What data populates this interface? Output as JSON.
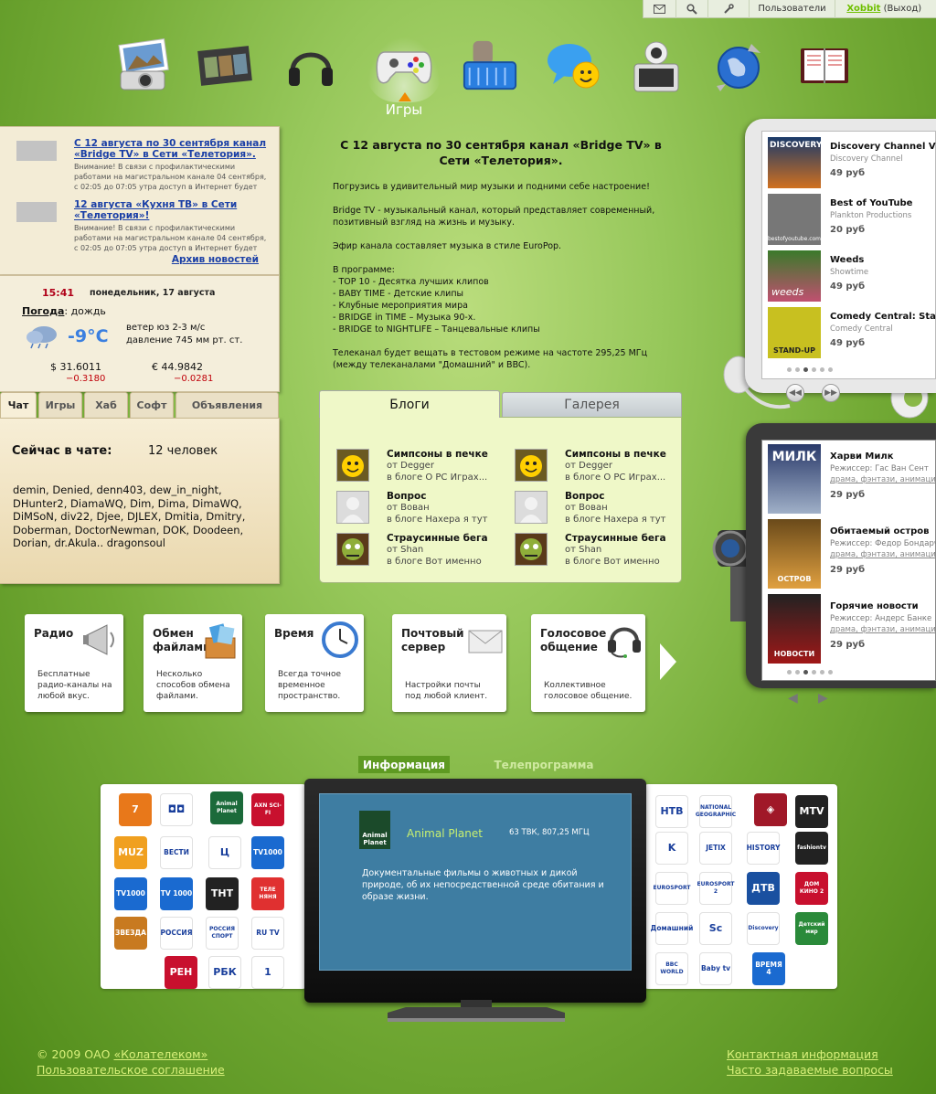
{
  "topbar": {
    "users": "Пользователи",
    "username": "Xobbit",
    "logout": "(Выход)"
  },
  "nav": {
    "active_label": "Игры",
    "icons": [
      "photo-camera-icon",
      "film-strip-icon",
      "headphones-icon",
      "gamepad-icon",
      "shopping-basket-icon",
      "chat-bubble-icon",
      "webcam-icon",
      "globe-icon",
      "planner-icon"
    ]
  },
  "news": {
    "items": [
      {
        "title": "С 12 августа по 30 сентября канал «Bridge TV» в Сети «Телетория».",
        "text": "Внимание! В связи с профилактическими работами на магистральном канале 04 сентября, с 02:05 до 07:05 утра доступ в Интернет будет"
      },
      {
        "title": "12 августа «Кухня ТВ» в Сети «Телетория»!",
        "text": "Внимание! В связи с профилактическими работами на магистральном канале 04 сентября, с 02:05 до 07:05 утра доступ в Интернет будет"
      }
    ],
    "archive": "Архив новостей"
  },
  "weather": {
    "time": "15:41",
    "date": "понедельник, 17 августа",
    "label": "Погода",
    "condition": "дождь",
    "temp": "-9°C",
    "wind": "ветер юз 2-3 м/с",
    "pressure": "давление 745 мм рт. ст.",
    "usd": "$ 31.6011",
    "usd_change": "−0.3180",
    "eur": "€ 44.9842",
    "eur_change": "−0.0281"
  },
  "tabs": [
    "Чат",
    "Игры",
    "Хаб",
    "Софт",
    "Объявления"
  ],
  "chat": {
    "heading": "Сейчас в чате:",
    "count": "12 человек",
    "users": "demin, Denied, denn403, dew_in_night, DHunter2, DiamaWQ, Dim, Dima, DimaWQ, DiMSoN, div22, Djee, DJLEX, Dmitia, Dmitry, Doberman, DoctorNewman, DOK, Doodeen, Dorian, dr.Akula.. dragonsoul"
  },
  "article": {
    "title": "С 12 августа по 30 сентября канал «Bridge TV» в Сети «Телетория».",
    "p1": "Погрузись в удивительный мир музыки и подними себе настроение!",
    "p2": "Bridge TV - музыкальный канал, который представляет современный, позитивный взгляд на жизнь и музыку.",
    "p3": "Эфир канала составляет музыка в стиле EuroPop.",
    "p4_head": "В программе:",
    "program": [
      "- TOP 10 - Десятка лучших клипов",
      "- BABY TIME - Детские клипы",
      "- Клубные мероприятия мира",
      "- BRIDGE in TIME – Музыка 90-х.",
      "- BRIDGE to NIGHTLIFE – Танцевальные клипы"
    ],
    "p5": "Телеканал будет вещать в тестовом режиме на частоте 295,25 МГц (между телеканалами \"Домашний\" и BBC)."
  },
  "blogs": {
    "tab_blogs": "Блоги",
    "tab_gallery": "Галерея",
    "entries": [
      {
        "title": "Симпсоны в печке",
        "author": "от Degger",
        "blog": "в блоге О PC Играх..."
      },
      {
        "title": "Симпсоны в печке",
        "author": "от Degger",
        "blog": "в блоге О PC Играх..."
      },
      {
        "title": "Вопрос",
        "author": "от Вован",
        "blog": "в блоге Нахера я тут"
      },
      {
        "title": "Вопрос",
        "author": "от Вован",
        "blog": "в блоге Нахера я тут"
      },
      {
        "title": "Страусинные бега",
        "author": "от Shan",
        "blog": "в блоге Вот именно"
      },
      {
        "title": "Страусинные бега",
        "author": "от Shan",
        "blog": "в блоге Вот именно"
      }
    ]
  },
  "store_video": [
    {
      "title": "Discovery Channel Video",
      "sub": "Discovery Channel",
      "price": "49 руб",
      "thumb": "DISCOVERY"
    },
    {
      "title": "Best of YouTube",
      "sub": "Plankton Productions",
      "price": "20 руб",
      "thumb": "bestofyoutube.com"
    },
    {
      "title": "Weeds",
      "sub": "Showtime",
      "price": "49 руб",
      "thumb": "weeds"
    },
    {
      "title": "Comedy Central: Stand-up",
      "sub": "Comedy Central",
      "price": "49 руб",
      "thumb": "STAND-UP"
    }
  ],
  "store_movies": [
    {
      "title": "Харви Милк",
      "sub": "Режиссер: Гас Ван Сент",
      "genres": "драма, фэнтази, анимационный",
      "price": "29 руб",
      "thumb": "МИЛК"
    },
    {
      "title": "Обитаемый остров",
      "sub": "Режиссер: Федор Бондарчук",
      "genres": "драма, фэнтази, анимационный",
      "price": "29 руб",
      "thumb": "ОСТРОВ"
    },
    {
      "title": "Горячие новости",
      "sub": "Режиссер: Андерс Банке",
      "genres": "драма, фэнтази, анимационный",
      "price": "29 руб",
      "thumb": "НОВОСТИ"
    }
  ],
  "services": [
    {
      "title": "Радио",
      "desc": "Бесплатные радио-каналы на любой вкус."
    },
    {
      "title": "Обмен файлами",
      "desc": "Несколько способов обмена файлами."
    },
    {
      "title": "Время",
      "desc": "Всегда точное временное пространство."
    },
    {
      "title": "Почтовый сервер",
      "desc": "Настройки почты под любой клиент."
    },
    {
      "title": "Голосовое общение",
      "desc": "Коллективное голосовое общение."
    }
  ],
  "info_tabs": {
    "info": "Информация",
    "tv": "Телепрограмма"
  },
  "channels_left": [
    "7",
    "◘◘",
    "Animal Planet",
    "AXN SCI-FI",
    "MUZ",
    "ВЕСТИ",
    "Ц",
    "TV1000",
    "TV1000",
    "TV 1000",
    "ТНТ",
    "ТЕЛЕ НЯНЯ",
    "ЗВЕЗДА",
    "РОССИЯ",
    "РОССИЯ СПОРТ",
    "RU TV",
    "РЕН",
    "РБК",
    "1"
  ],
  "channels_right": [
    "НТВ",
    "NATIONAL GEOGRAPHIC",
    "◈",
    "MTV",
    "K",
    "JETIX",
    "HISTORY",
    "fashiontv",
    "EUROSPORT",
    "EUROSPORT 2",
    "ДТВ",
    "ДОМ КИНО 2",
    "Домашний",
    "Sc",
    "Discovery",
    "Детский мир",
    "BBC WORLD",
    "Baby tv",
    "ВРЕМЯ 4"
  ],
  "tv": {
    "channel": "Animal Planet",
    "freq": "63 ТВК, 807,25 МГЦ",
    "logo": "Animal Planet",
    "desc": "Документальные фильмы о животных и дикой природе, об их непосредственной среде обитания и образе жизни."
  },
  "footer": {
    "copyright": "© 2009 ОАО ",
    "company": "«Колателеком»",
    "agreement": "Пользовательское соглашение",
    "contacts": "Контактная информация",
    "faq": "Часто задаваемые вопросы"
  },
  "colors": {
    "accent_green": "#6fbf00",
    "link_blue": "#1a3fa6",
    "negative_red": "#c0000a",
    "tv_screen": "#3e7da2"
  }
}
